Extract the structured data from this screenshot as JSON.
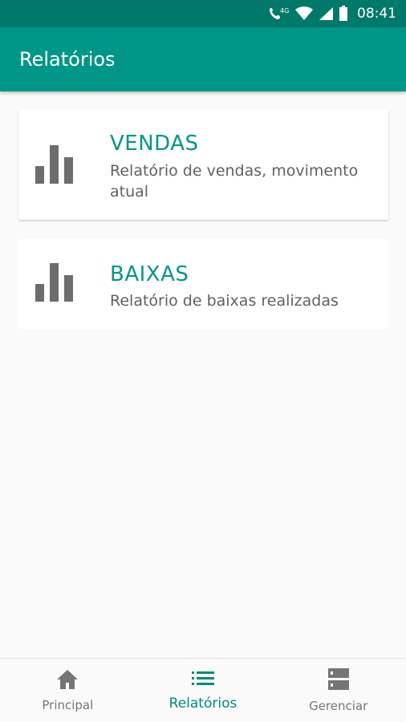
{
  "status_bar": {
    "time": "08:41",
    "network": "4G",
    "icons": [
      "call-4g-icon",
      "wifi-icon",
      "signal-icon",
      "battery-icon"
    ],
    "color": "#00796b"
  },
  "app_bar": {
    "title": "Relatórios",
    "color": "#009688"
  },
  "reports": [
    {
      "title": "VENDAS",
      "description": "Relatório de vendas, movimento atual",
      "icon": "bar-chart-icon"
    },
    {
      "title": "BAIXAS",
      "description": "Relatório de baixas realizadas",
      "icon": "bar-chart-icon"
    }
  ],
  "bottom_nav": {
    "items": [
      {
        "label": "Principal",
        "icon": "home-icon",
        "active": false
      },
      {
        "label": "Relatórios",
        "icon": "list-icon",
        "active": true
      },
      {
        "label": "Gerenciar",
        "icon": "storage-icon",
        "active": false
      }
    ],
    "active_color": "#00897b"
  }
}
